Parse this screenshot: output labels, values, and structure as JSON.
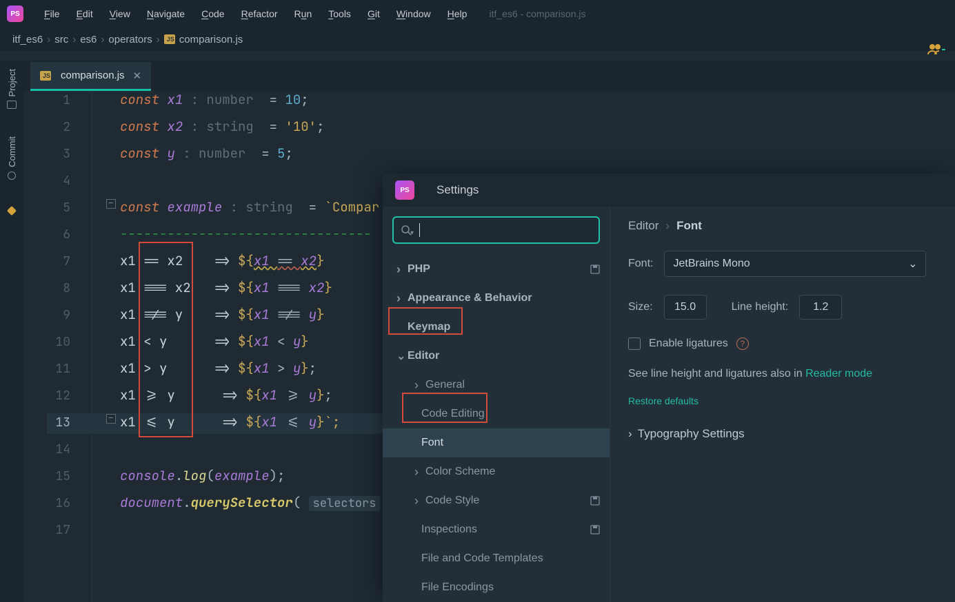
{
  "menu": [
    "File",
    "Edit",
    "View",
    "Navigate",
    "Code",
    "Refactor",
    "Run",
    "Tools",
    "Git",
    "Window",
    "Help"
  ],
  "window_title": "itf_es6 - comparison.js",
  "breadcrumb": [
    "itf_es6",
    "src",
    "es6",
    "operators",
    "comparison.js"
  ],
  "tab": {
    "file": "comparison.js"
  },
  "left_tools": {
    "project": "Project",
    "commit": "Commit"
  },
  "gutter": [
    "1",
    "2",
    "3",
    "4",
    "5",
    "6",
    "7",
    "8",
    "9",
    "10",
    "11",
    "12",
    "13",
    "14",
    "15",
    "16",
    "17"
  ],
  "code": {
    "const": "const",
    "x1": "x1",
    "x2": "x2",
    "y": "y",
    "example": "example",
    "hint_number": " : number  ",
    "hint_string": " : string  ",
    "eq": "=",
    "ten": "10",
    "ten_s": "'10'",
    "five": "5",
    "semi": ";",
    "backtick": "`",
    "compar": "Compar",
    "dashline": "--------------------------------",
    "l7_a": "x1 ",
    "l7_op": "==",
    "l7_b": " x2",
    "l7_arrow": "    => ",
    "l7_tpl_open": "${",
    "l7_expr_a": "x1 ",
    "l7_expr_op": "== ",
    "l7_expr_b": "x2",
    "l7_tpl_close": "}",
    "l8_op": "===",
    "l9_a": "x1 ",
    "l9_op": "!==",
    "l9_b": " y",
    "l9_expr_b": "y",
    "l10_op": "<",
    "l11_op": ">",
    "l11_semi": ";",
    "l12_op": ">=",
    "l12_semi": ";",
    "l13_op": "<=",
    "l13_close": "}`;",
    "console": "console",
    "dot": ".",
    "log": "log",
    "open": "(",
    "close": ")",
    "document": "document",
    "querySelector": "querySelector",
    "selectors_hint": "selectors"
  },
  "settings": {
    "title": "Settings",
    "search_placeholder": "",
    "tree": {
      "php": "PHP",
      "appearance": "Appearance & Behavior",
      "keymap": "Keymap",
      "editor": "Editor",
      "general": "General",
      "code_editing": "Code Editing",
      "font": "Font",
      "color_scheme": "Color Scheme",
      "code_style": "Code Style",
      "inspections": "Inspections",
      "file_templates": "File and Code Templates",
      "file_encodings": "File Encodings"
    },
    "right": {
      "bc_a": "Editor",
      "bc_b": "Font",
      "font_label": "Font:",
      "font_value": "JetBrains Mono",
      "size_label": "Size:",
      "size_value": "15.0",
      "lh_label": "Line height:",
      "lh_value": "1.2",
      "ligatures": "Enable ligatures",
      "hint_pre": "See line height and ligatures also in ",
      "hint_link": "Reader mode",
      "restore": "Restore defaults",
      "typo": "Typography Settings"
    }
  }
}
